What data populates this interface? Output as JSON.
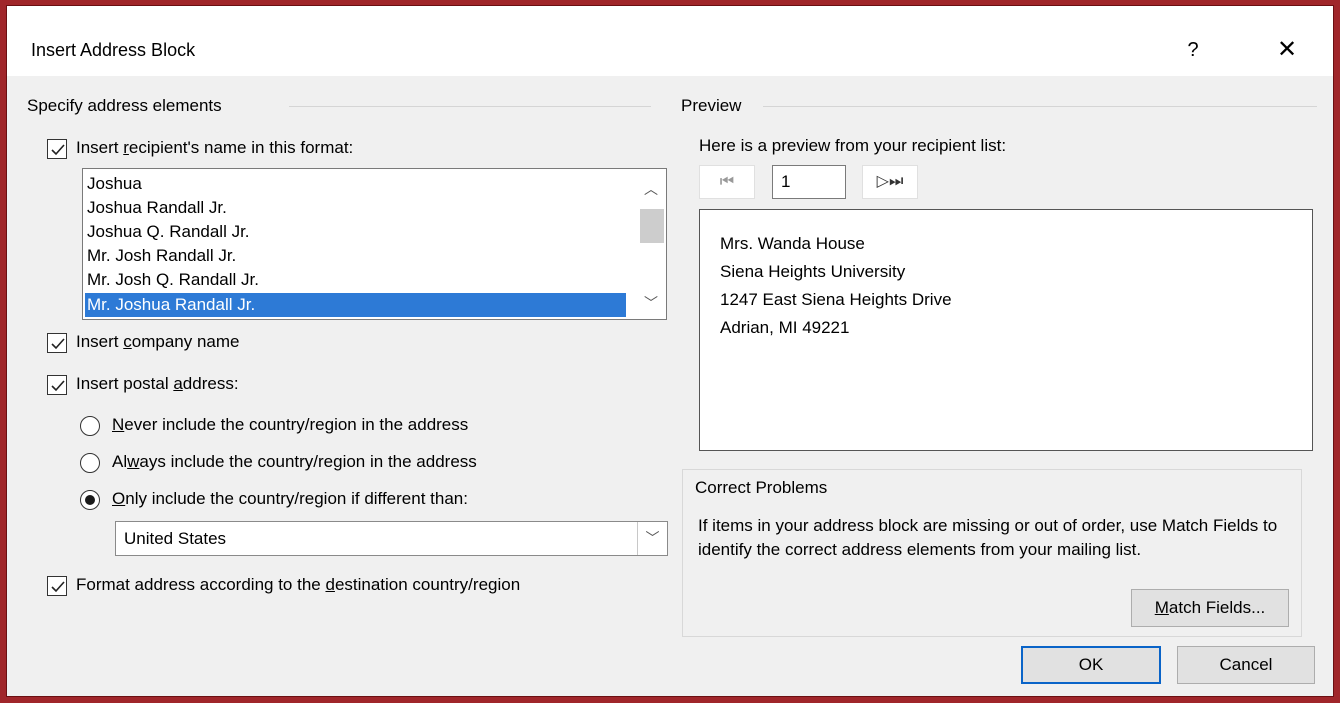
{
  "window": {
    "title": "Insert Address Block",
    "help_label": "?",
    "close_label": "✕"
  },
  "left": {
    "group_title": "Specify address elements",
    "recipient_name": {
      "checked": true,
      "label_pre": "Insert ",
      "label_u": "r",
      "label_post": "ecipient's name in this format:"
    },
    "name_formats": [
      "Joshua",
      "Joshua Randall Jr.",
      "Joshua Q. Randall Jr.",
      "Mr. Josh Randall Jr.",
      "Mr. Josh Q. Randall Jr.",
      "Mr. Joshua Randall Jr."
    ],
    "selected_format_index": 5,
    "company": {
      "checked": true,
      "label_pre": "Insert ",
      "label_u": "c",
      "label_post": "ompany name"
    },
    "postal": {
      "checked": true,
      "label_pre": "Insert postal ",
      "label_u": "a",
      "label_post": "ddress:"
    },
    "radio_never": {
      "selected": false,
      "label_u": "N",
      "label_post": "ever include the country/region in the address"
    },
    "radio_always": {
      "selected": false,
      "label_pre": "Al",
      "label_u": "w",
      "label_post": "ays include the country/region in the address"
    },
    "radio_only": {
      "selected": true,
      "label_u": "O",
      "label_post": "nly include the country/region if different than:"
    },
    "country_value": "United States",
    "format_dest": {
      "checked": true,
      "label_pre": "Format address according to the ",
      "label_u": "d",
      "label_post": "estination country/region"
    }
  },
  "preview": {
    "group_title": "Preview",
    "subtitle": "Here is a preview from your recipient list:",
    "record_number": "1",
    "address_lines": [
      "Mrs. Wanda House",
      "Siena Heights University",
      "1247 East Siena Heights Drive",
      "Adrian, MI 49221"
    ]
  },
  "correct_problems": {
    "title": "Correct Problems",
    "text": "If items in your address block are missing or out of order, use Match Fields to identify the correct address elements from your mailing list.",
    "match_fields_u": "M",
    "match_fields_post": "atch Fields..."
  },
  "buttons": {
    "ok": "OK",
    "cancel": "Cancel"
  }
}
